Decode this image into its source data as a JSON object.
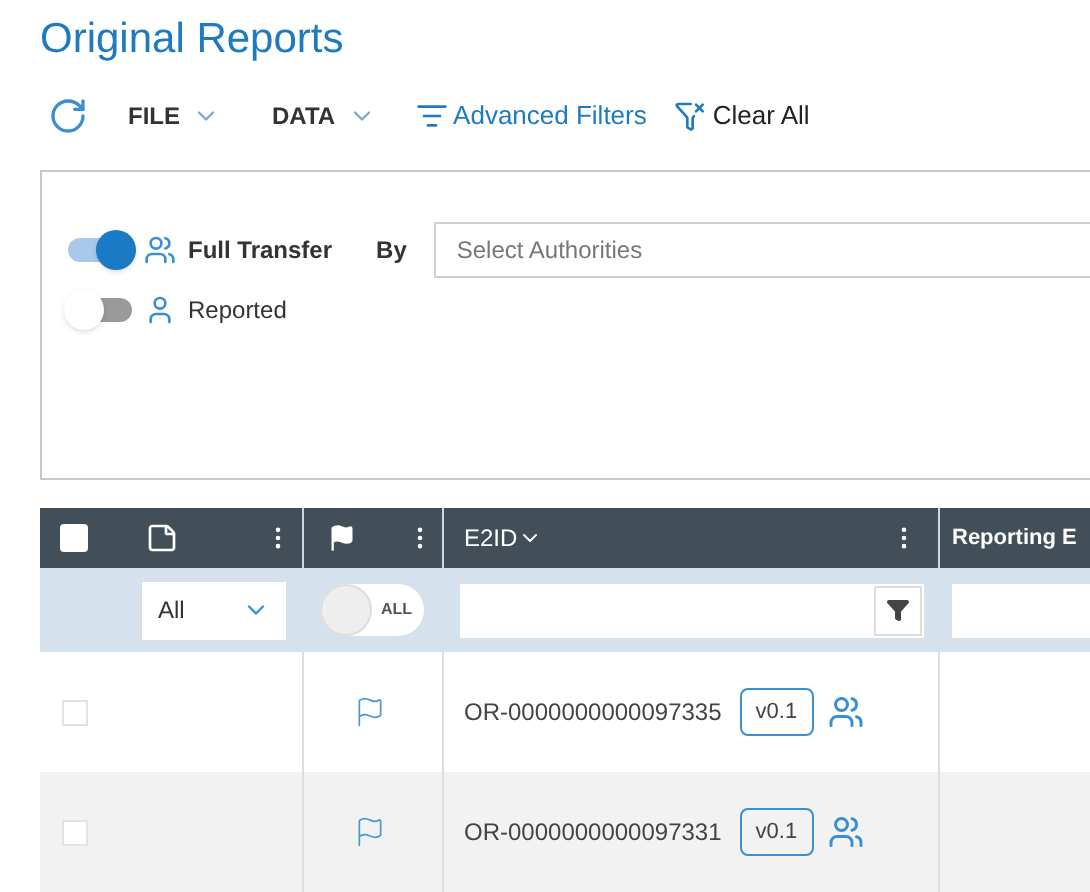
{
  "title": "Original Reports",
  "toolbar": {
    "menus": [
      {
        "label": "FILE"
      },
      {
        "label": "DATA"
      }
    ],
    "advanced_filters": "Advanced Filters",
    "clear_all": "Clear All"
  },
  "filters": {
    "toggles": [
      {
        "label": "Full Transfer",
        "on": true,
        "kind": "group"
      },
      {
        "label": "Reported",
        "on": false,
        "kind": "person"
      }
    ],
    "by_label": "By",
    "authorities": {
      "placeholder": "Select Authorities"
    }
  },
  "table": {
    "select_all": {
      "checked": false
    },
    "columns": [
      {
        "label": "E2ID"
      },
      {
        "label": "Reporting E"
      }
    ],
    "filter_row": {
      "note_filter": "All",
      "flag_toggle": {
        "label": "ALL",
        "on": false
      }
    },
    "rows": [
      {
        "id": "OR-0000000000097335",
        "version": "v0.1",
        "selected": false
      },
      {
        "id": "OR-0000000000097331",
        "version": "v0.1",
        "selected": false
      }
    ]
  }
}
